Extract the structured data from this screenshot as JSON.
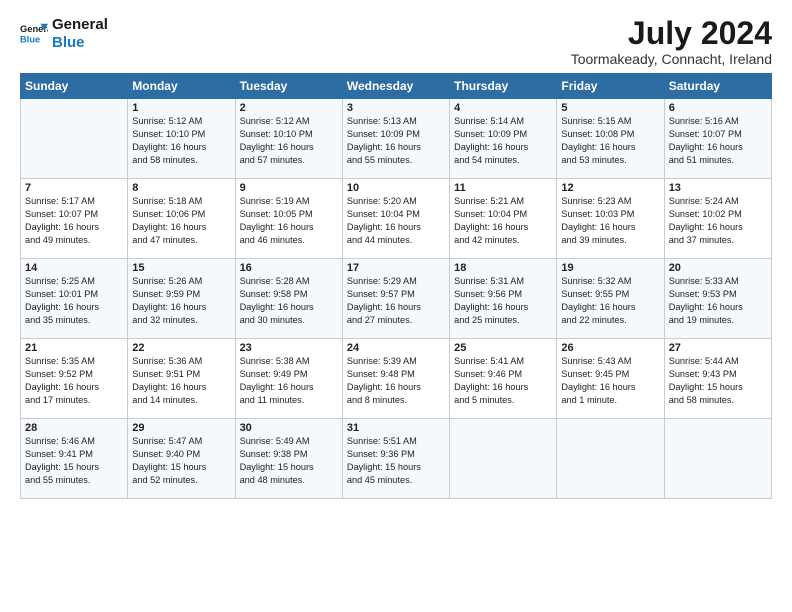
{
  "header": {
    "logo_line1": "General",
    "logo_line2": "Blue",
    "month": "July 2024",
    "location": "Toormakeady, Connacht, Ireland"
  },
  "days_of_week": [
    "Sunday",
    "Monday",
    "Tuesday",
    "Wednesday",
    "Thursday",
    "Friday",
    "Saturday"
  ],
  "weeks": [
    [
      {
        "day": "",
        "content": ""
      },
      {
        "day": "1",
        "content": "Sunrise: 5:12 AM\nSunset: 10:10 PM\nDaylight: 16 hours\nand 58 minutes."
      },
      {
        "day": "2",
        "content": "Sunrise: 5:12 AM\nSunset: 10:10 PM\nDaylight: 16 hours\nand 57 minutes."
      },
      {
        "day": "3",
        "content": "Sunrise: 5:13 AM\nSunset: 10:09 PM\nDaylight: 16 hours\nand 55 minutes."
      },
      {
        "day": "4",
        "content": "Sunrise: 5:14 AM\nSunset: 10:09 PM\nDaylight: 16 hours\nand 54 minutes."
      },
      {
        "day": "5",
        "content": "Sunrise: 5:15 AM\nSunset: 10:08 PM\nDaylight: 16 hours\nand 53 minutes."
      },
      {
        "day": "6",
        "content": "Sunrise: 5:16 AM\nSunset: 10:07 PM\nDaylight: 16 hours\nand 51 minutes."
      }
    ],
    [
      {
        "day": "7",
        "content": "Sunrise: 5:17 AM\nSunset: 10:07 PM\nDaylight: 16 hours\nand 49 minutes."
      },
      {
        "day": "8",
        "content": "Sunrise: 5:18 AM\nSunset: 10:06 PM\nDaylight: 16 hours\nand 47 minutes."
      },
      {
        "day": "9",
        "content": "Sunrise: 5:19 AM\nSunset: 10:05 PM\nDaylight: 16 hours\nand 46 minutes."
      },
      {
        "day": "10",
        "content": "Sunrise: 5:20 AM\nSunset: 10:04 PM\nDaylight: 16 hours\nand 44 minutes."
      },
      {
        "day": "11",
        "content": "Sunrise: 5:21 AM\nSunset: 10:04 PM\nDaylight: 16 hours\nand 42 minutes."
      },
      {
        "day": "12",
        "content": "Sunrise: 5:23 AM\nSunset: 10:03 PM\nDaylight: 16 hours\nand 39 minutes."
      },
      {
        "day": "13",
        "content": "Sunrise: 5:24 AM\nSunset: 10:02 PM\nDaylight: 16 hours\nand 37 minutes."
      }
    ],
    [
      {
        "day": "14",
        "content": "Sunrise: 5:25 AM\nSunset: 10:01 PM\nDaylight: 16 hours\nand 35 minutes."
      },
      {
        "day": "15",
        "content": "Sunrise: 5:26 AM\nSunset: 9:59 PM\nDaylight: 16 hours\nand 32 minutes."
      },
      {
        "day": "16",
        "content": "Sunrise: 5:28 AM\nSunset: 9:58 PM\nDaylight: 16 hours\nand 30 minutes."
      },
      {
        "day": "17",
        "content": "Sunrise: 5:29 AM\nSunset: 9:57 PM\nDaylight: 16 hours\nand 27 minutes."
      },
      {
        "day": "18",
        "content": "Sunrise: 5:31 AM\nSunset: 9:56 PM\nDaylight: 16 hours\nand 25 minutes."
      },
      {
        "day": "19",
        "content": "Sunrise: 5:32 AM\nSunset: 9:55 PM\nDaylight: 16 hours\nand 22 minutes."
      },
      {
        "day": "20",
        "content": "Sunrise: 5:33 AM\nSunset: 9:53 PM\nDaylight: 16 hours\nand 19 minutes."
      }
    ],
    [
      {
        "day": "21",
        "content": "Sunrise: 5:35 AM\nSunset: 9:52 PM\nDaylight: 16 hours\nand 17 minutes."
      },
      {
        "day": "22",
        "content": "Sunrise: 5:36 AM\nSunset: 9:51 PM\nDaylight: 16 hours\nand 14 minutes."
      },
      {
        "day": "23",
        "content": "Sunrise: 5:38 AM\nSunset: 9:49 PM\nDaylight: 16 hours\nand 11 minutes."
      },
      {
        "day": "24",
        "content": "Sunrise: 5:39 AM\nSunset: 9:48 PM\nDaylight: 16 hours\nand 8 minutes."
      },
      {
        "day": "25",
        "content": "Sunrise: 5:41 AM\nSunset: 9:46 PM\nDaylight: 16 hours\nand 5 minutes."
      },
      {
        "day": "26",
        "content": "Sunrise: 5:43 AM\nSunset: 9:45 PM\nDaylight: 16 hours\nand 1 minute."
      },
      {
        "day": "27",
        "content": "Sunrise: 5:44 AM\nSunset: 9:43 PM\nDaylight: 15 hours\nand 58 minutes."
      }
    ],
    [
      {
        "day": "28",
        "content": "Sunrise: 5:46 AM\nSunset: 9:41 PM\nDaylight: 15 hours\nand 55 minutes."
      },
      {
        "day": "29",
        "content": "Sunrise: 5:47 AM\nSunset: 9:40 PM\nDaylight: 15 hours\nand 52 minutes."
      },
      {
        "day": "30",
        "content": "Sunrise: 5:49 AM\nSunset: 9:38 PM\nDaylight: 15 hours\nand 48 minutes."
      },
      {
        "day": "31",
        "content": "Sunrise: 5:51 AM\nSunset: 9:36 PM\nDaylight: 15 hours\nand 45 minutes."
      },
      {
        "day": "",
        "content": ""
      },
      {
        "day": "",
        "content": ""
      },
      {
        "day": "",
        "content": ""
      }
    ]
  ]
}
